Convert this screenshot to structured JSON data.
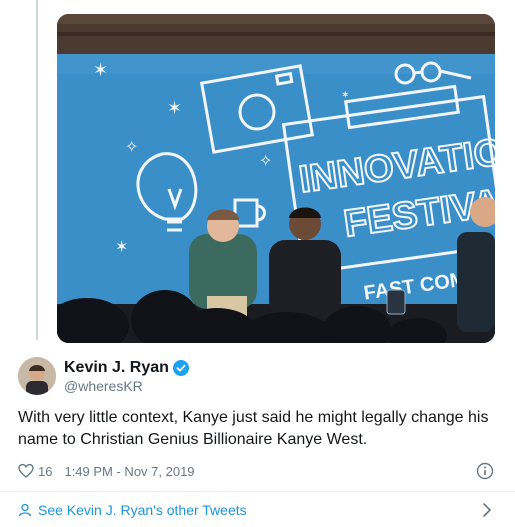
{
  "photo": {
    "banner_line1": "INNOVATION",
    "banner_line2": "FESTIVAL",
    "banner_brand": "FAST COMPANY"
  },
  "author": {
    "name": "Kevin J. Ryan",
    "handle": "@wheresKR",
    "verified": true
  },
  "tweet": {
    "text": "With very little context, Kanye just said he might legally change his name to Christian Genius Billionaire Kanye West.",
    "like_count": "16",
    "timestamp": "1:49 PM - Nov 7, 2019"
  },
  "footer": {
    "link_label": "See Kevin J. Ryan's other Tweets"
  },
  "colors": {
    "link_blue": "#1b95e0",
    "verified_blue": "#1da1f2",
    "muted_gray": "#657786",
    "stage_blue": "#3a8fc8"
  }
}
